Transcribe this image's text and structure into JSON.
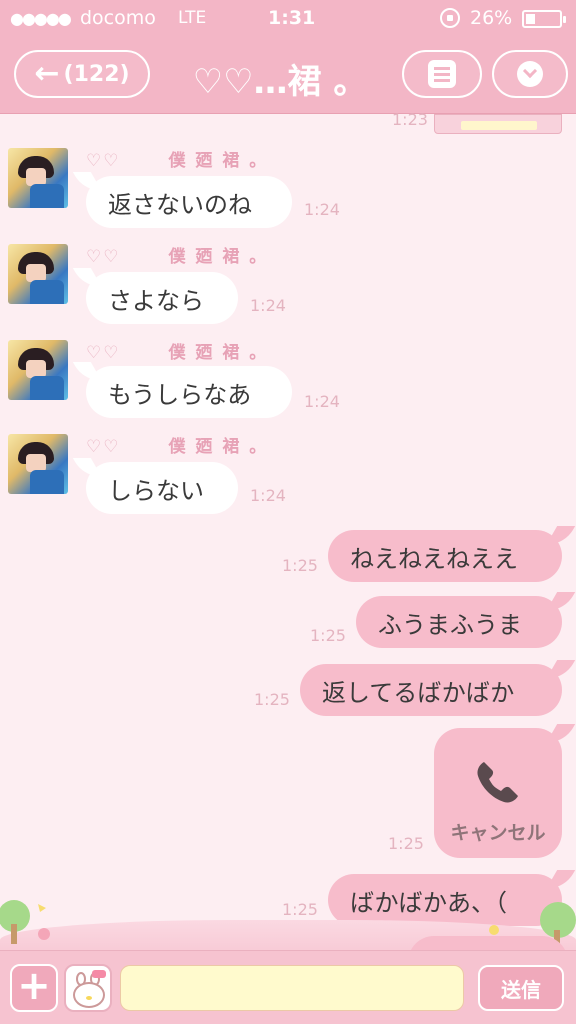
{
  "status_bar": {
    "signal": "●●●●●",
    "carrier": "docomo",
    "network": "LTE",
    "time": "1:31",
    "battery_percent": "26%"
  },
  "nav": {
    "back_arrow": "←",
    "unread_count": "(122)",
    "title": "♡♡…裙 。"
  },
  "top_clipped_time": "1:23",
  "incoming": {
    "sender_hearts": "♡♡",
    "sender_name": "僕 廼 裙 。",
    "messages": [
      {
        "text": "返さないのね",
        "time": "1:24"
      },
      {
        "text": "さよなら",
        "time": "1:24"
      },
      {
        "text": "もうしらなあ",
        "time": "1:24"
      },
      {
        "text": "しらない",
        "time": "1:24"
      }
    ]
  },
  "outgoing": {
    "messages": [
      {
        "text": "ねえねえねええ",
        "time": "1:25"
      },
      {
        "text": "ふうまふうま",
        "time": "1:25"
      },
      {
        "text": "返してるばかばか",
        "time": "1:25"
      },
      {
        "text": "ばかばかあ、（",
        "time": "1:25"
      }
    ],
    "call": {
      "label": "キャンセル",
      "time": "1:25",
      "icon": "phone-icon"
    }
  },
  "input_bar": {
    "plus_label": "+",
    "placeholder": "",
    "send_label": "送信"
  },
  "colors": {
    "header_pink": "#f3b6c6",
    "background": "#fdeef2",
    "outgoing_bubble": "#f7bccb",
    "incoming_bubble": "#ffffff",
    "input_field": "#fffacd"
  }
}
